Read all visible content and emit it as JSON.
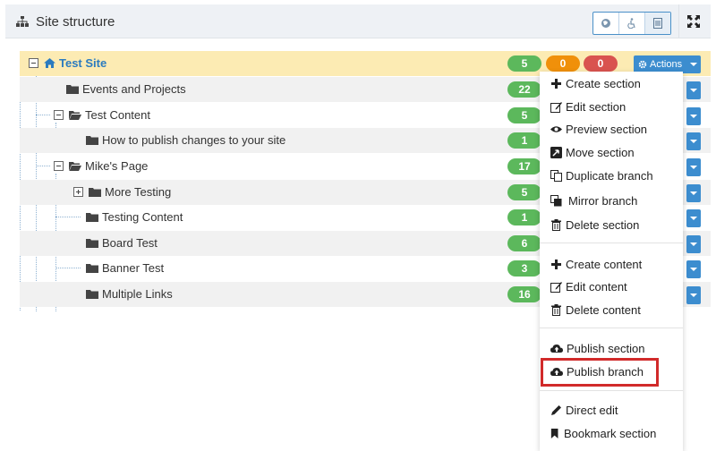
{
  "panel": {
    "title": "Site structure",
    "toggle_icons": [
      "globe-icon",
      "accessibility-icon",
      "document-icon"
    ],
    "expand_icon": "expand-arrows-icon"
  },
  "tree": {
    "root": {
      "label": "Test Site",
      "count": "5",
      "pending": "0",
      "errors": "0",
      "actions_label": "Actions"
    },
    "rows": [
      {
        "label": "Events and Projects",
        "count": "22"
      },
      {
        "label": "Test Content",
        "count": "5"
      },
      {
        "label": "How to publish changes to your site",
        "count": "1"
      },
      {
        "label": "Mike's Page",
        "count": "17"
      },
      {
        "label": "More Testing",
        "count": "5"
      },
      {
        "label": "Testing Content",
        "count": "1"
      },
      {
        "label": "Board Test",
        "count": "6"
      },
      {
        "label": "Banner Test",
        "count": "3"
      },
      {
        "label": "Multiple Links",
        "count": "16"
      }
    ]
  },
  "menu": {
    "section_items": [
      "Create section",
      "Edit section",
      "Preview section",
      "Move section",
      "Duplicate branch",
      "Mirror branch",
      "Delete section"
    ],
    "content_items": [
      "Create content",
      "Edit content",
      "Delete content"
    ],
    "publish_items": [
      "Publish section",
      "Publish branch"
    ],
    "other_items": [
      "Direct edit",
      "Bookmark section"
    ]
  },
  "colors": {
    "accent": "#3c8dcf",
    "highlight_row": "#fcebb3",
    "badge_green": "#5cb85c",
    "badge_orange": "#f0900a",
    "badge_red": "#d9534f",
    "annotation_red": "#d12a2a"
  }
}
